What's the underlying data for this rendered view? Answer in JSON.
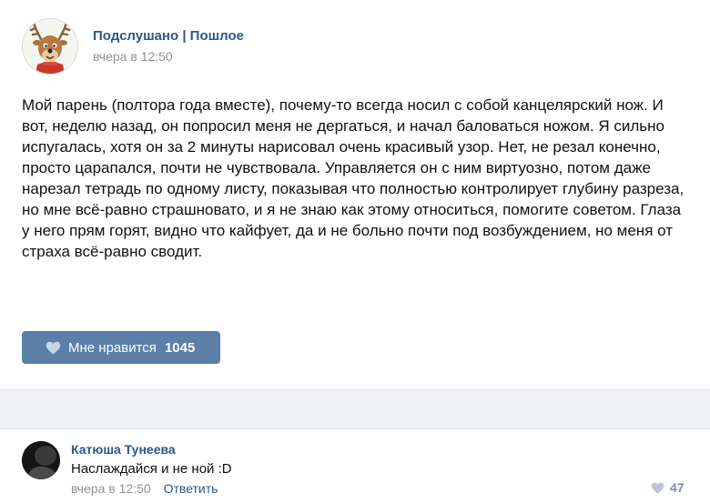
{
  "post": {
    "group_name": "Подслушано | Пошлое",
    "time": "вчера в 12:50",
    "text": "Мой парень (полтора года вместе), почему-то всегда носил с собой канцелярский нож. И вот, неделю назад, он попросил меня не дергаться, и начал баловаться ножом. Я сильно испугалась, хотя он за 2 минуты нарисовал очень красивый узор. Нет, не резал конечно, просто царапался, почти не чувствовала. Управляется он с ним виртуозно, потом даже нарезал тетрадь по одному листу, показывая что полностью контролирует глубину разреза, но мне всё-равно страшновато, и я не знаю как этому относиться, помогите советом. Глаза у него прям горят, видно что кайфует, да и не больно почти под возбуждением, но меня от страха всё-равно сводит.",
    "like_label": "Мне нравится",
    "like_count": "1045",
    "avatar_icon": "reindeer-avatar-icon"
  },
  "comment": {
    "author": "Катюша Тунеева",
    "text": "Наслаждайся и не ной :D",
    "time": "вчера в 12:50",
    "reply_label": "Ответить",
    "like_count": "47"
  },
  "colors": {
    "link": "#2a5885",
    "like_button": "#5b7fa6",
    "meta": "#939393",
    "band": "#f0f2f5"
  }
}
